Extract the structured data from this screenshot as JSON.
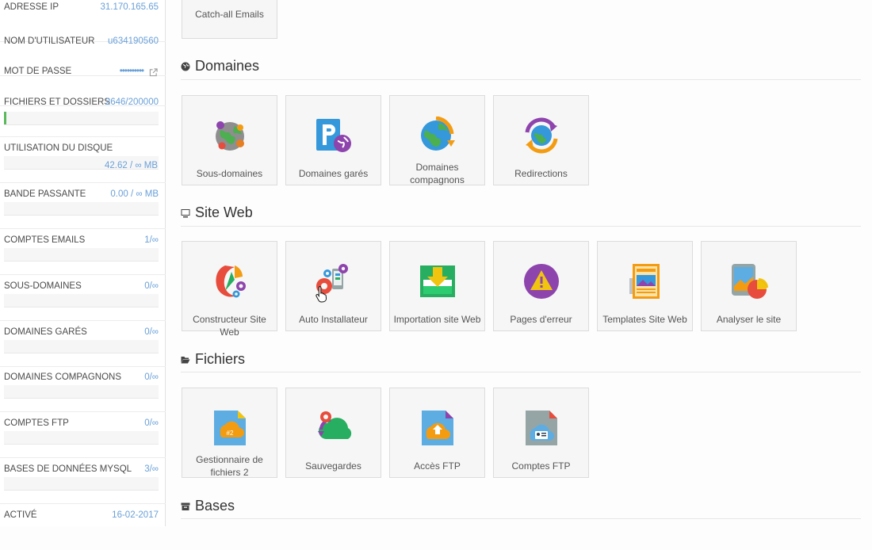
{
  "sidebar": {
    "stats": [
      {
        "label": "ADRESSE IP",
        "value": "31.170.165.65"
      },
      {
        "label": "NOM D'UTILISATEUR",
        "value": "u634190560"
      },
      {
        "label": "MOT DE PASSE",
        "value": "••••••••••"
      },
      {
        "label": "FICHIERS ET DOSSIERS",
        "value": "2646/200000",
        "progress": 0.013
      },
      {
        "label": "UTILISATION DU DISQUE",
        "value": "42.62 / ∞ MB"
      },
      {
        "label": "BANDE PASSANTE",
        "value": "0.00 / ∞ MB"
      },
      {
        "label": "COMPTES EMAILS",
        "value": "1/∞"
      },
      {
        "label": "SOUS-DOMAINES",
        "value": "0/∞"
      },
      {
        "label": "DOMAINES GARÉS",
        "value": "0/∞"
      },
      {
        "label": "DOMAINES COMPAGNONS",
        "value": "0/∞"
      },
      {
        "label": "COMPTES FTP",
        "value": "0/∞"
      },
      {
        "label": "BASES DE DONNÉES MYSQL",
        "value": "3/∞"
      },
      {
        "label": "ACTIVÉ",
        "value": "16-02-2017"
      }
    ]
  },
  "top_tile": {
    "label": "Catch-all Emails"
  },
  "sections": {
    "domaines": {
      "title": "Domaines",
      "tiles": [
        {
          "label": "Sous-domaines",
          "icon": "subdomains-icon"
        },
        {
          "label": "Domaines garés",
          "icon": "parked-domains-icon"
        },
        {
          "label": "Domaines compagnons",
          "icon": "addon-domains-icon"
        },
        {
          "label": "Redirections",
          "icon": "redirects-icon"
        }
      ]
    },
    "siteweb": {
      "title": "Site Web",
      "tiles": [
        {
          "label": "Constructeur Site Web",
          "icon": "website-builder-icon"
        },
        {
          "label": "Auto Installateur",
          "icon": "auto-installer-icon"
        },
        {
          "label": "Importation site Web",
          "icon": "import-website-icon"
        },
        {
          "label": "Pages d'erreur",
          "icon": "error-pages-icon"
        },
        {
          "label": "Templates Site Web",
          "icon": "website-templates-icon"
        },
        {
          "label": "Analyser le site",
          "icon": "analyze-site-icon"
        }
      ]
    },
    "fichiers": {
      "title": "Fichiers",
      "tiles": [
        {
          "label": "Gestionnaire de fichiers 2",
          "icon": "file-manager-icon"
        },
        {
          "label": "Sauvegardes",
          "icon": "backups-icon"
        },
        {
          "label": "Accès FTP",
          "icon": "ftp-access-icon"
        },
        {
          "label": "Comptes FTP",
          "icon": "ftp-accounts-icon"
        }
      ]
    },
    "bases": {
      "title": "Bases"
    }
  },
  "colors": {
    "accent": "#6aa0d8",
    "progress": "#5cb85c"
  }
}
